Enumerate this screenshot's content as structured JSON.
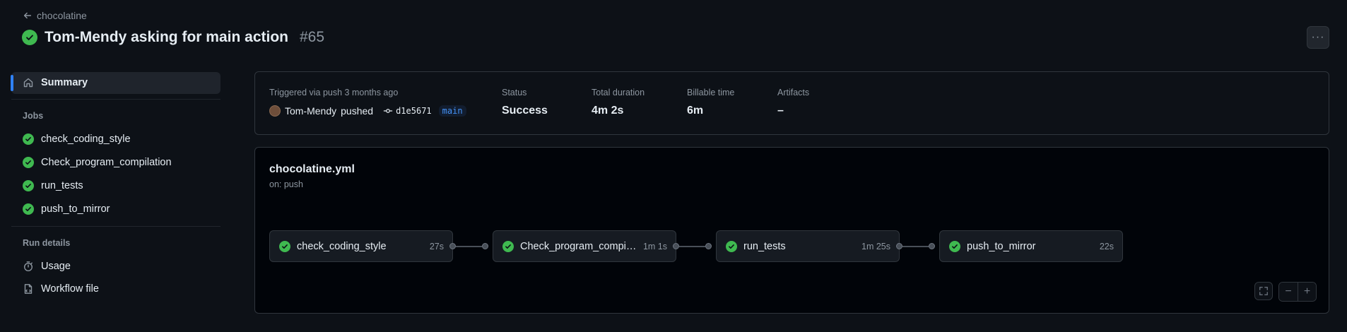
{
  "header": {
    "back_label": "chocolatine",
    "title": "Tom-Mendy asking for main action",
    "run_number": "#65",
    "more_label": "···"
  },
  "sidebar": {
    "summary_label": "Summary",
    "jobs_heading": "Jobs",
    "jobs": [
      {
        "label": "check_coding_style"
      },
      {
        "label": "Check_program_compilation"
      },
      {
        "label": "run_tests"
      },
      {
        "label": "push_to_mirror"
      }
    ],
    "run_details_heading": "Run details",
    "usage_label": "Usage",
    "workflow_file_label": "Workflow file"
  },
  "summary": {
    "triggered_label": "Triggered via push 3 months ago",
    "actor": "Tom-Mendy",
    "action": "pushed",
    "commit": "d1e5671",
    "branch": "main",
    "status_label": "Status",
    "status_value": "Success",
    "duration_label": "Total duration",
    "duration_value": "4m 2s",
    "billable_label": "Billable time",
    "billable_value": "6m",
    "artifacts_label": "Artifacts",
    "artifacts_value": "–"
  },
  "workflow": {
    "file": "chocolatine.yml",
    "trigger": "on: push",
    "jobs": [
      {
        "name": "check_coding_style",
        "time": "27s"
      },
      {
        "name": "Check_program_compilation",
        "time": "1m 1s"
      },
      {
        "name": "run_tests",
        "time": "1m 25s"
      },
      {
        "name": "push_to_mirror",
        "time": "22s"
      }
    ],
    "zoom_out_label": "−",
    "zoom_in_label": "+"
  },
  "colors": {
    "success": "#3fb950",
    "accent": "#2f81f7",
    "background": "#0d1117"
  },
  "icons": [
    "arrow-left-icon",
    "check-circle-icon",
    "home-icon",
    "stopwatch-icon",
    "file-icon",
    "commit-icon",
    "fullscreen-icon"
  ]
}
